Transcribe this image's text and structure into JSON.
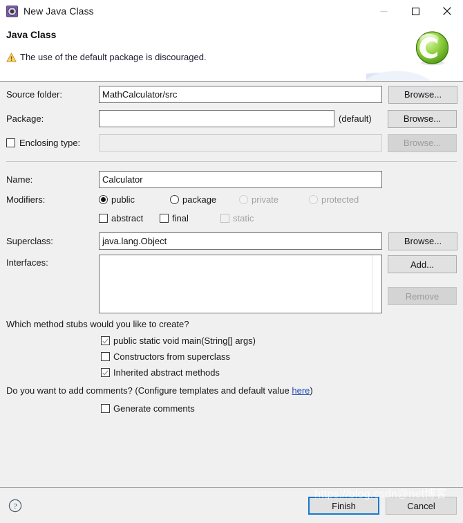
{
  "window": {
    "title": "New Java Class",
    "app_icon": "java-class-gear-icon",
    "controls": {
      "minimize": "minimize-icon",
      "maximize": "maximize-icon",
      "close": "close-icon"
    }
  },
  "header": {
    "title": "Java Class",
    "message": "The use of the default package is discouraged.",
    "message_icon": "warning-triangle-icon",
    "badge_icon": "green-class-c-icon",
    "warning_color": "#f0b429",
    "accent_color": "#1878cf",
    "link_color": "#2049b0"
  },
  "form": {
    "source_folder": {
      "label": "Source folder:",
      "value": "MathCalculator/src",
      "placeholder": "",
      "browse_label": "Browse..."
    },
    "package": {
      "label": "Package:",
      "value": "",
      "placeholder": "",
      "default_hint": "(default)",
      "browse_label": "Browse..."
    },
    "enclosing_type": {
      "label": "Enclosing type:",
      "checked": false,
      "value": "",
      "placeholder": "",
      "browse_label": "Browse...",
      "disabled": true
    },
    "name": {
      "label": "Name:",
      "value": "Calculator",
      "placeholder": ""
    },
    "modifiers": {
      "label": "Modifiers:",
      "radios": [
        {
          "label": "public",
          "selected": true,
          "disabled": false
        },
        {
          "label": "package",
          "selected": false,
          "disabled": false
        },
        {
          "label": "private",
          "selected": false,
          "disabled": true
        },
        {
          "label": "protected",
          "selected": false,
          "disabled": true
        }
      ],
      "checkboxes": [
        {
          "label": "abstract",
          "checked": false,
          "disabled": false
        },
        {
          "label": "final",
          "checked": false,
          "disabled": false
        },
        {
          "label": "static",
          "checked": false,
          "disabled": true
        }
      ]
    },
    "superclass": {
      "label": "Superclass:",
      "value": "java.lang.Object",
      "placeholder": "",
      "browse_label": "Browse..."
    },
    "interfaces": {
      "label": "Interfaces:",
      "items": [],
      "add_label": "Add...",
      "remove_label": "Remove",
      "remove_disabled": true
    },
    "method_stubs": {
      "question": "Which method stubs would you like to create?",
      "options": [
        {
          "label": "public static void main(String[] args)",
          "checked": true
        },
        {
          "label": "Constructors from superclass",
          "checked": false
        },
        {
          "label": "Inherited abstract methods",
          "checked": true
        }
      ]
    },
    "comments": {
      "question_prefix": "Do you want to add comments? (Configure templates and default value ",
      "link_label": "here",
      "question_suffix": ")",
      "option": {
        "label": "Generate comments",
        "checked": false
      }
    }
  },
  "footer": {
    "help_label": "?",
    "finish_label": "Finish",
    "cancel_label": "Cancel"
  },
  "overlay": {
    "watermark_ascii": "https://blog.csdn@net",
    "watermark_cjk": "博客"
  }
}
